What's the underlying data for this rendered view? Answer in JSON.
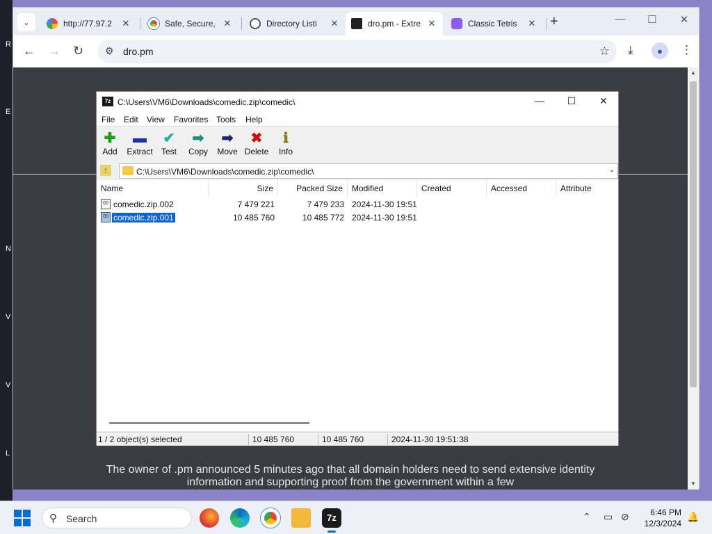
{
  "browser": {
    "tabs": [
      {
        "label": "http://77.97.2",
        "active": false
      },
      {
        "label": "Safe, Secure,",
        "active": false
      },
      {
        "label": "Directory Listi",
        "active": false
      },
      {
        "label": "dro.pm - Extre",
        "active": true
      },
      {
        "label": "Classic Tetris",
        "active": false
      }
    ],
    "url": "dro.pm",
    "page_notice": "The owner of .pm announced 5 minutes ago that all domain holders need to send extensive identity information and supporting proof from the government within a few"
  },
  "sevenzip": {
    "title": "C:\\Users\\VM6\\Downloads\\comedic.zip\\comedic\\",
    "logo": "7z",
    "menu": [
      "File",
      "Edit",
      "View",
      "Favorites",
      "Tools",
      "Help"
    ],
    "tools": [
      {
        "label": "Add",
        "icon": "plus-icon",
        "glyph": "✚",
        "color": "#1ea01e"
      },
      {
        "label": "Extract",
        "icon": "minus-icon",
        "glyph": "▬",
        "color": "#1c2fa8"
      },
      {
        "label": "Test",
        "icon": "check-icon",
        "glyph": "✔",
        "color": "#18b0a0"
      },
      {
        "label": "Copy",
        "icon": "arrow-right-icon",
        "glyph": "➡",
        "color": "#1a8f7a"
      },
      {
        "label": "Move",
        "icon": "arrow-right-icon",
        "glyph": "➡",
        "color": "#1c2478"
      },
      {
        "label": "Delete",
        "icon": "x-icon",
        "glyph": "✖",
        "color": "#d01010"
      },
      {
        "label": "Info",
        "icon": "info-icon",
        "glyph": "ℹ",
        "color": "#8a7a10"
      }
    ],
    "address": "C:\\Users\\VM6\\Downloads\\comedic.zip\\comedic\\",
    "columns": [
      "Name",
      "Size",
      "Packed Size",
      "Modified",
      "Created",
      "Accessed",
      "Attribute"
    ],
    "files": [
      {
        "name": "comedic.zip.002",
        "size": "7 479 221",
        "packed": "7 479 233",
        "modified": "2024-11-30 19:51",
        "selected": false
      },
      {
        "name": "comedic.zip.001",
        "size": "10 485 760",
        "packed": "10 485 772",
        "modified": "2024-11-30 19:51",
        "selected": true
      }
    ],
    "status": {
      "selection": "1 / 2 object(s) selected",
      "size": "10 485 760",
      "packed": "10 485 760",
      "modified": "2024-11-30 19:51:38"
    }
  },
  "taskbar": {
    "search_placeholder": "Search",
    "time": "6:46 PM",
    "date": "12/3/2024"
  }
}
